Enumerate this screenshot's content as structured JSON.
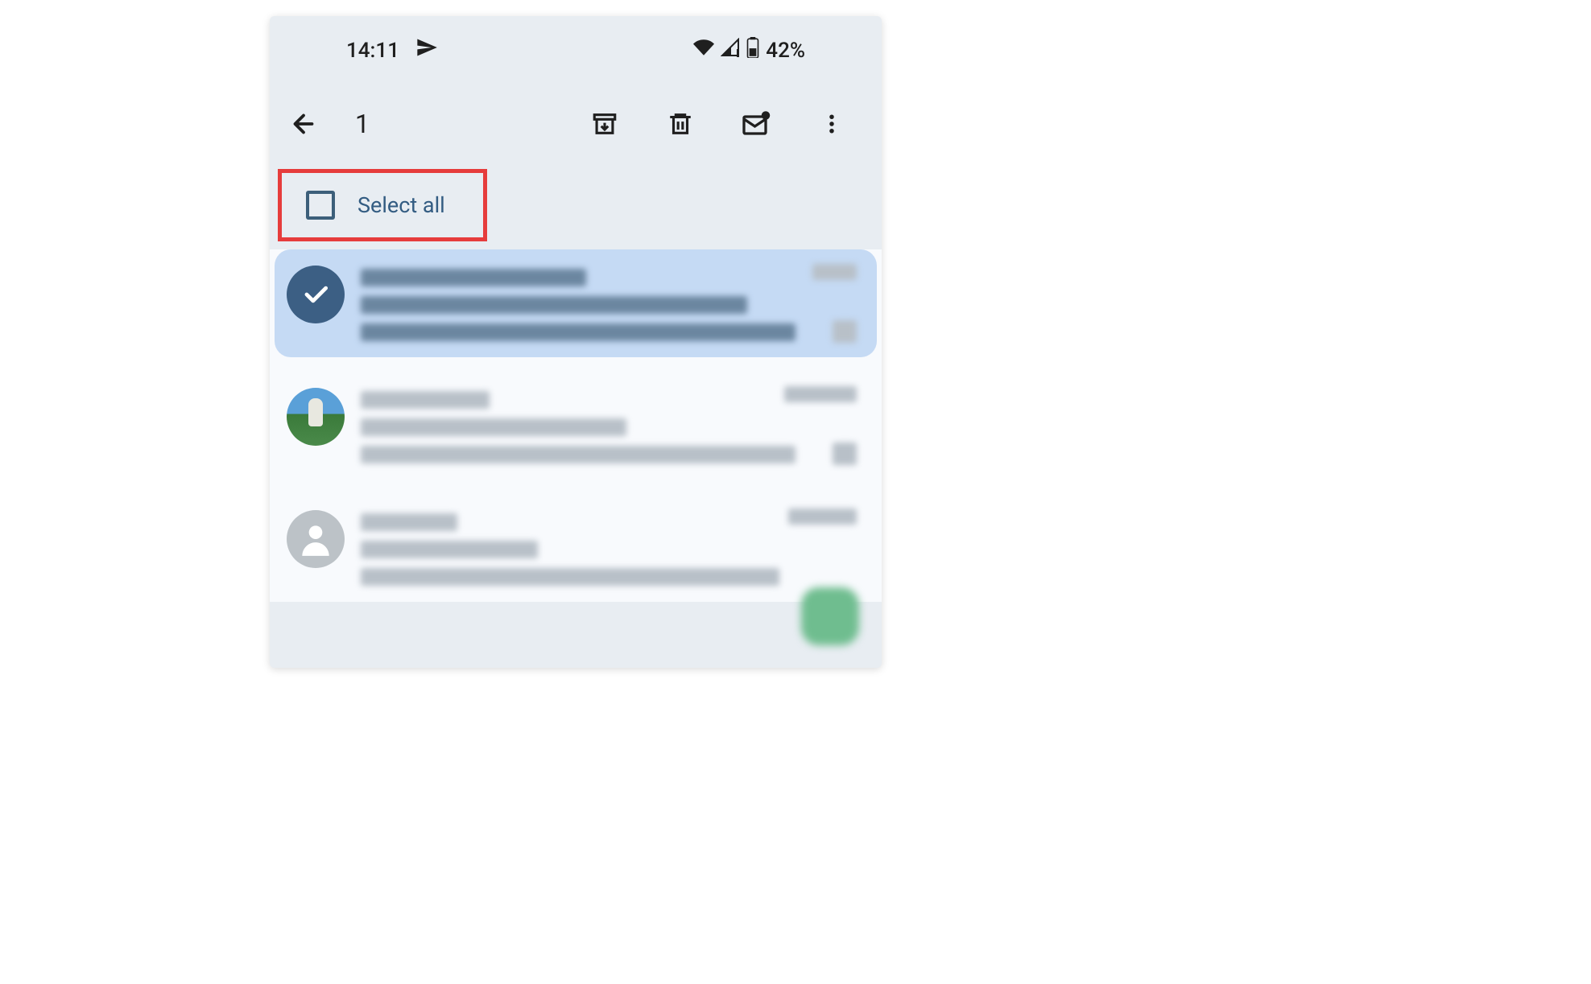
{
  "status_bar": {
    "time": "14:11",
    "battery": "42%"
  },
  "action_bar": {
    "selected_count": "1"
  },
  "select_all": {
    "label": "Select all"
  },
  "emails": [
    {
      "selected": true,
      "avatar_type": "check"
    },
    {
      "selected": false,
      "avatar_type": "image"
    },
    {
      "selected": false,
      "avatar_type": "generic"
    }
  ]
}
